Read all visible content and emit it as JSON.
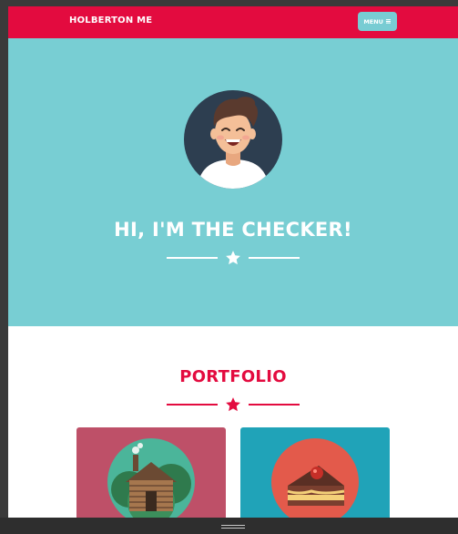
{
  "navbar": {
    "brand": "HOLBERTON ME",
    "menu_label": "MENU",
    "menu_icon": "hamburger-icon"
  },
  "hero": {
    "avatar_icon": "avatar-illustration",
    "title": "HI, I'M THE CHECKER!",
    "divider_icon": "star-icon"
  },
  "portfolio": {
    "title": "PORTFOLIO",
    "divider_icon": "star-icon",
    "items": [
      {
        "icon": "log-cabin-icon",
        "color": "#be5068"
      },
      {
        "icon": "cake-slice-icon",
        "color": "#20a3b8"
      }
    ]
  },
  "colors": {
    "accent": "#e30b3f",
    "hero_bg": "#78ced3",
    "menu_button": "#78ccd3"
  }
}
